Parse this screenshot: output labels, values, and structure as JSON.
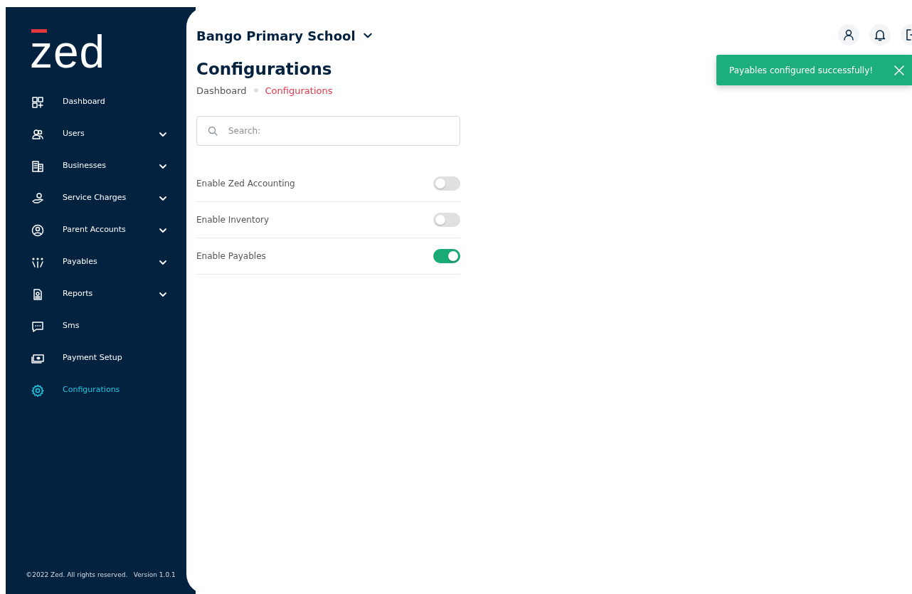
{
  "logo": "zed",
  "sidebar": {
    "items": [
      {
        "label": "Dashboard",
        "expandable": false,
        "selected": false
      },
      {
        "label": "Users",
        "expandable": true,
        "selected": false
      },
      {
        "label": "Businesses",
        "expandable": true,
        "selected": false
      },
      {
        "label": "Service Charges",
        "expandable": true,
        "selected": false
      },
      {
        "label": "Parent Accounts",
        "expandable": true,
        "selected": false
      },
      {
        "label": "Payables",
        "expandable": true,
        "selected": false
      },
      {
        "label": "Reports",
        "expandable": true,
        "selected": false
      },
      {
        "label": "Sms",
        "expandable": false,
        "selected": false
      },
      {
        "label": "Payment Setup",
        "expandable": false,
        "selected": false
      },
      {
        "label": "Configurations",
        "expandable": false,
        "selected": true
      }
    ],
    "footer": "©2022 Zed. All rights reserved.   Version 1.0.1"
  },
  "header": {
    "school": "Bango Primary School"
  },
  "page": {
    "title": "Configurations",
    "breadcrumb": [
      {
        "label": "Dashboard",
        "selected": false
      },
      {
        "label": "Configurations",
        "selected": true
      }
    ]
  },
  "search": {
    "placeholder": "Search:"
  },
  "settings": [
    {
      "label": "Enable Zed Accounting",
      "on": false
    },
    {
      "label": "Enable Inventory",
      "on": false
    },
    {
      "label": "Enable Payables",
      "on": true
    }
  ],
  "toast": {
    "message": "Payables configured successfully!"
  }
}
